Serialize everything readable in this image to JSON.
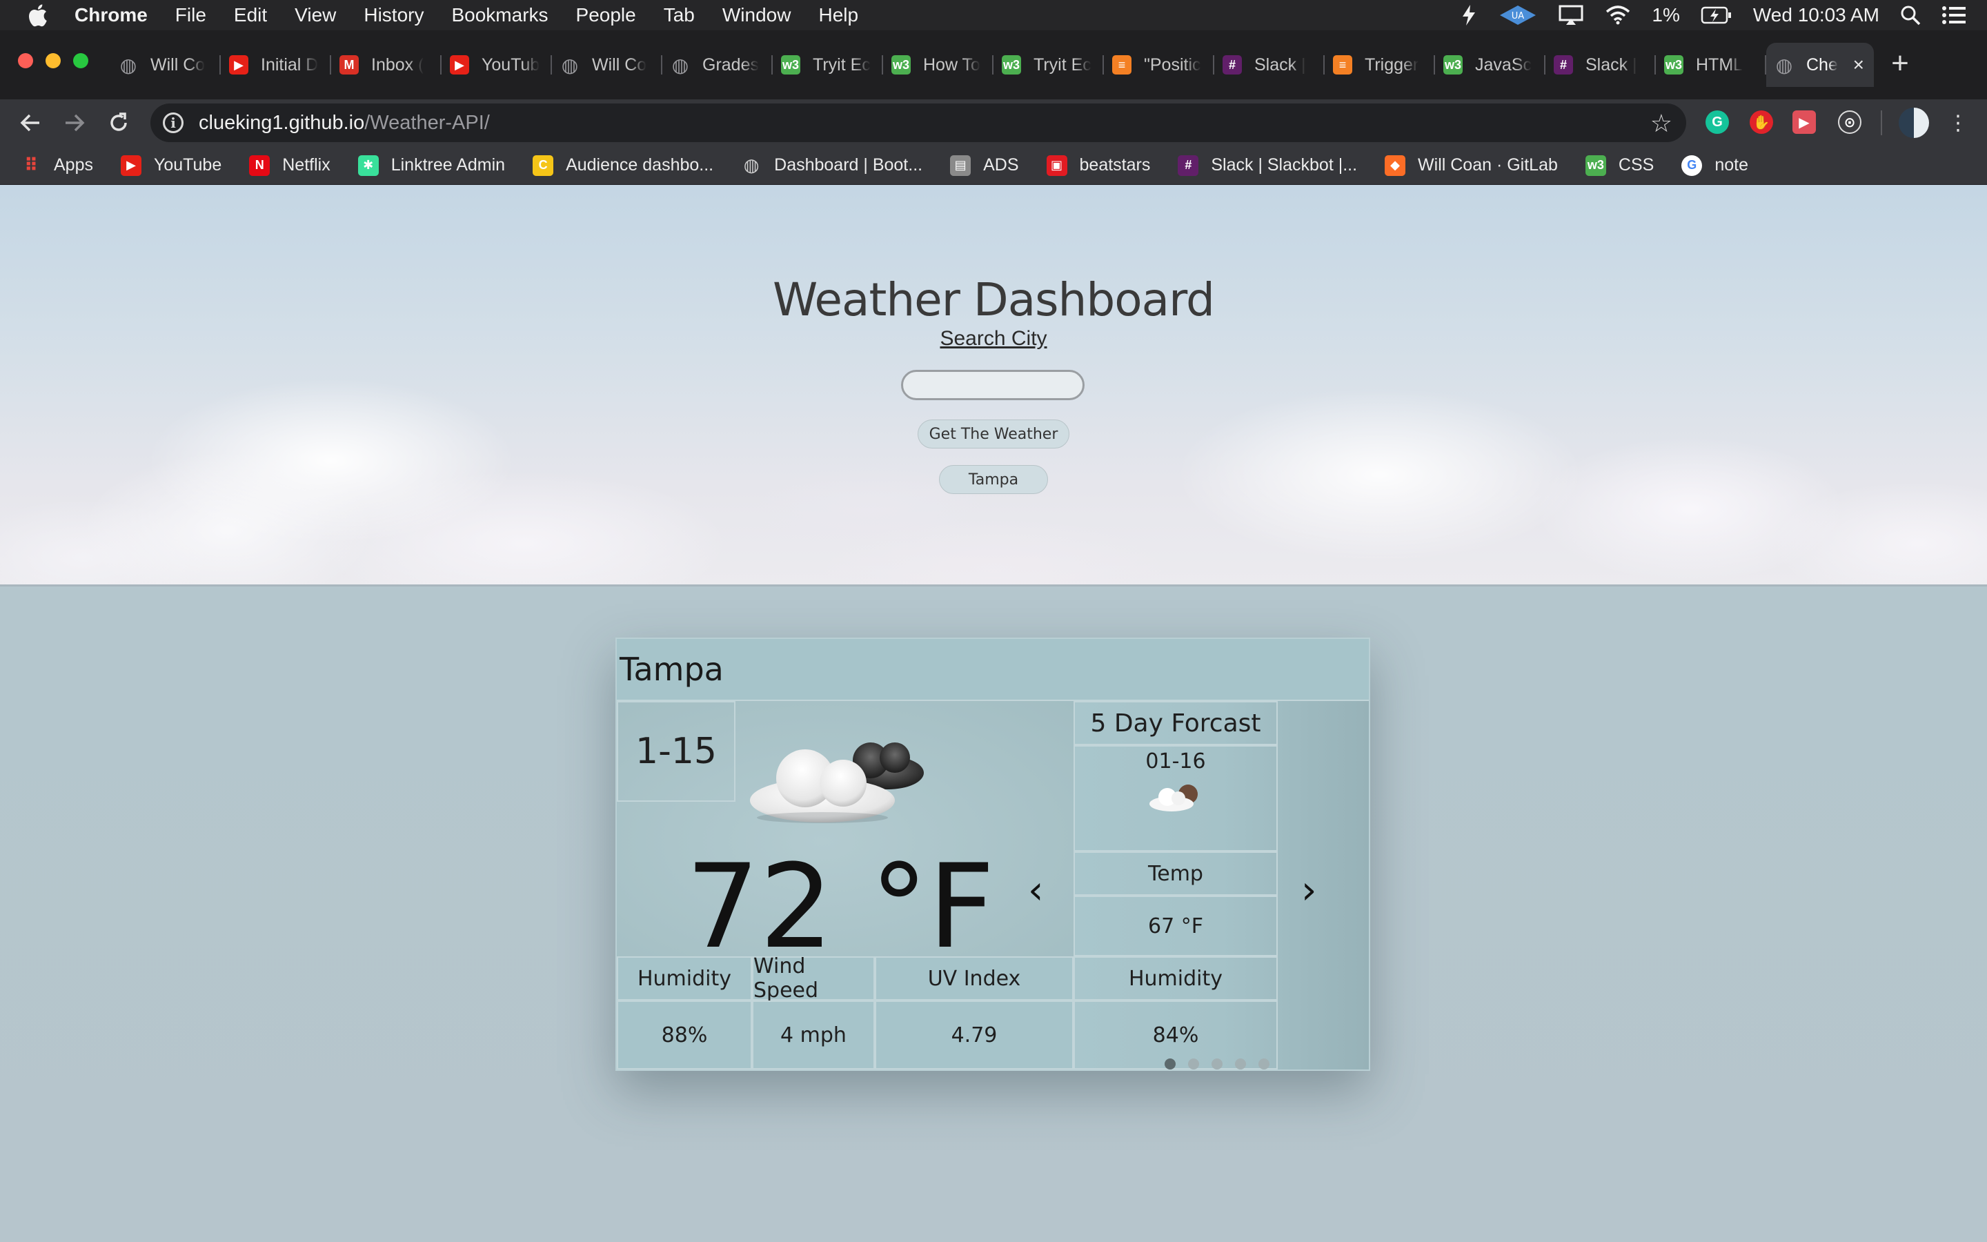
{
  "menubar": {
    "app": "Chrome",
    "items": [
      "File",
      "Edit",
      "View",
      "History",
      "Bookmarks",
      "People",
      "Tab",
      "Window",
      "Help"
    ],
    "battery": "1%",
    "clock": "Wed 10:03 AM"
  },
  "tabs": [
    {
      "title": "Will Co",
      "icon": "globe-icon",
      "color": "#5f6368"
    },
    {
      "title": "Initial D",
      "icon": "youtube-icon",
      "color": "#e62117"
    },
    {
      "title": "Inbox (",
      "icon": "gmail-icon",
      "color": "#d93025"
    },
    {
      "title": "YouTub",
      "icon": "youtube-icon",
      "color": "#e62117"
    },
    {
      "title": "Will Co",
      "icon": "globe-icon",
      "color": "#5f6368"
    },
    {
      "title": "Grades",
      "icon": "globe-icon",
      "color": "#5f6368"
    },
    {
      "title": "Tryit Ec",
      "icon": "w3schools-icon",
      "color": "#4caf50"
    },
    {
      "title": "How To",
      "icon": "w3schools-icon",
      "color": "#4caf50"
    },
    {
      "title": "Tryit Ec",
      "icon": "w3schools-icon",
      "color": "#4caf50"
    },
    {
      "title": "\"Positic",
      "icon": "stackoverflow-icon",
      "color": "#f48024"
    },
    {
      "title": "Slack |",
      "icon": "slack-icon",
      "color": "#611f69"
    },
    {
      "title": "Trigger",
      "icon": "stackoverflow-icon",
      "color": "#f48024"
    },
    {
      "title": "JavaSc",
      "icon": "w3schools-icon",
      "color": "#4caf50"
    },
    {
      "title": "Slack |",
      "icon": "slack-icon",
      "color": "#611f69"
    },
    {
      "title": "HTML",
      "icon": "w3schools-icon",
      "color": "#4caf50"
    }
  ],
  "active_tab": {
    "title": "Che",
    "icon": "globe-icon"
  },
  "toolbar": {
    "url_host": "clueking1.github.io",
    "url_path": "/Weather-API/"
  },
  "bookmarks": [
    {
      "label": "Apps",
      "icon": "apps-grid-icon",
      "color": "#4285f4"
    },
    {
      "label": "YouTube",
      "icon": "youtube-icon",
      "color": "#e62117"
    },
    {
      "label": "Netflix",
      "icon": "netflix-icon",
      "color": "#e50914"
    },
    {
      "label": "Linktree Admin",
      "icon": "linktree-icon",
      "color": "#39e09b"
    },
    {
      "label": "Audience dashbo...",
      "icon": "audience-icon",
      "color": "#f5c518"
    },
    {
      "label": "Dashboard | Boot...",
      "icon": "globe-icon",
      "color": "#5f6368"
    },
    {
      "label": "ADS",
      "icon": "ads-icon",
      "color": "#8a8a8a"
    },
    {
      "label": "beatstars",
      "icon": "beatstars-icon",
      "color": "#e11b22"
    },
    {
      "label": "Slack | Slackbot |...",
      "icon": "slack-icon",
      "color": "#611f69"
    },
    {
      "label": "Will Coan · GitLab",
      "icon": "gitlab-icon",
      "color": "#fc6d26"
    },
    {
      "label": "CSS",
      "icon": "w3schools-icon",
      "color": "#4caf50"
    },
    {
      "label": "note",
      "icon": "google-icon",
      "color": "#ffffff"
    }
  ],
  "hero": {
    "title": "Weather Dashboard",
    "search_label": "Search City",
    "input_value": "",
    "button_label": "Get The Weather",
    "history": [
      "Tampa"
    ]
  },
  "current": {
    "city": "Tampa",
    "date": "1-15",
    "icon": "partly-cloudy-icon",
    "temp": "72 °F",
    "stats": [
      {
        "label": "Humidity",
        "value": "88%"
      },
      {
        "label": "Wind Speed",
        "value": "4 mph"
      },
      {
        "label": "UV Index",
        "value": "4.79"
      }
    ]
  },
  "forecast": {
    "title": "5 Day Forcast",
    "date": "01-16",
    "icon": "partly-cloudy-icon",
    "temp_label": "Temp",
    "temp": "67 °F",
    "humidity_label": "Humidity",
    "humidity": "84%",
    "prev_label": "‹",
    "next_label": "›",
    "slides": 5,
    "active_slide": 1
  }
}
